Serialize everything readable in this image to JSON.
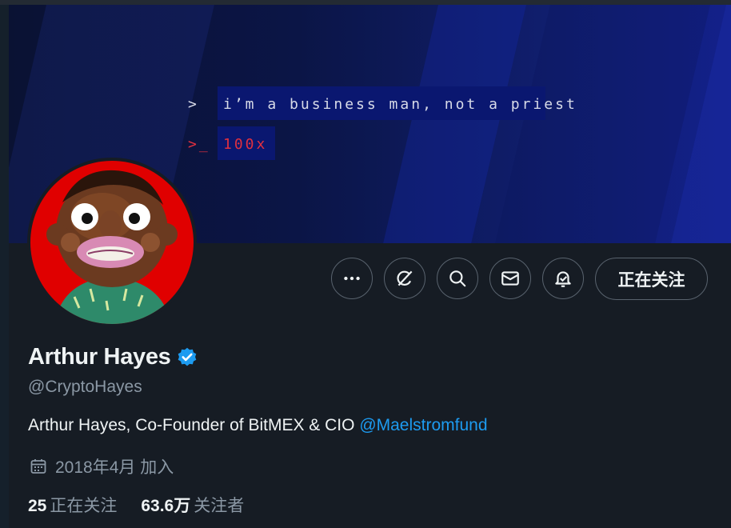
{
  "banner": {
    "line1_prompt": ">",
    "line1_text": "i’m a business man, not a priest",
    "line2_prompt": ">_",
    "line2_text": "100x",
    "colors": {
      "text": "#d8dbe8",
      "accent": "#e0303f",
      "highlight": "#0a1770"
    }
  },
  "avatar": {
    "icon": "profile-avatar",
    "background": "#e00000"
  },
  "actions": {
    "more_icon": "more-dots-icon",
    "grok_icon": "grok-slash-icon",
    "search_icon": "search-icon",
    "message_icon": "envelope-icon",
    "notify_icon": "bell-check-icon",
    "follow_label": "正在关注"
  },
  "profile": {
    "name": "Arthur Hayes",
    "verified": true,
    "verified_color": "#1d9bf0",
    "handle": "@CryptoHayes",
    "bio_text": "Arthur Hayes, Co-Founder of BitMEX & CIO ",
    "bio_mention": "@Maelstromfund",
    "joined": "2018年4月 加入",
    "following_count": "25",
    "following_label": "正在关注",
    "followers_count": "63.6万",
    "followers_label": "关注者"
  }
}
